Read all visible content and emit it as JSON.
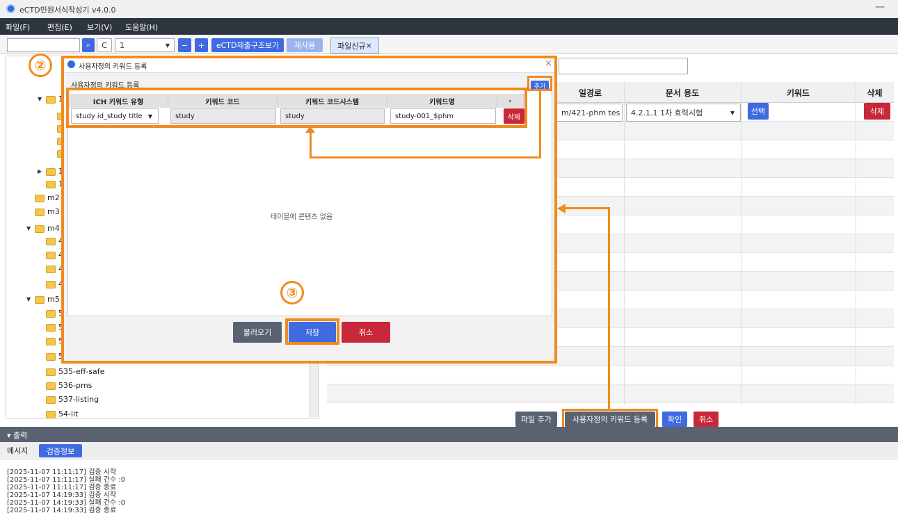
{
  "app": {
    "title": "eCTD민원서식작성기 v4.0.0",
    "minimize": "—"
  },
  "menu": [
    "파일(F)",
    "편집(E)",
    "보기(V)",
    "도움말(H)"
  ],
  "toolbar": {
    "page_value": "1",
    "refresh_icon": "C",
    "minus": "−",
    "plus": "+",
    "structure_btn": "eCTD제출구조보기",
    "reuse_btn": "재사용",
    "tab": "파일신규",
    "tab_close": "×"
  },
  "tree": [
    {
      "label": "1",
      "indent": 1,
      "toggle": "▼"
    },
    {
      "label": "",
      "indent": 2
    },
    {
      "label": "",
      "indent": 2
    },
    {
      "label": "",
      "indent": 2
    },
    {
      "label": "",
      "indent": 2
    },
    {
      "label": "1",
      "indent": 1,
      "toggle": "▶"
    },
    {
      "label": "1",
      "indent": 1
    },
    {
      "label": "m2",
      "indent": 0
    },
    {
      "label": "m3",
      "indent": 0
    },
    {
      "label": "m4",
      "indent": 0,
      "toggle": "▼"
    },
    {
      "label": "4",
      "indent": 1
    },
    {
      "label": "4",
      "indent": 1
    },
    {
      "label": "4",
      "indent": 1
    },
    {
      "label": "4",
      "indent": 1
    },
    {
      "label": "m5",
      "indent": 0,
      "toggle": "▼"
    },
    {
      "label": "5",
      "indent": 1
    },
    {
      "label": "5",
      "indent": 1
    },
    {
      "label": "5",
      "indent": 1
    },
    {
      "label": "5",
      "indent": 1
    },
    {
      "label": "535-eff-safe",
      "indent": 1
    },
    {
      "label": "536-pms",
      "indent": 1
    },
    {
      "label": "537-listing",
      "indent": 1
    },
    {
      "label": "54-lit",
      "indent": 1
    }
  ],
  "grid": {
    "headers": {
      "path": "일경로",
      "purpose": "문서 용도",
      "keyword": "키워드",
      "delete": "삭제"
    },
    "row1": {
      "path": "m/421-phm tes",
      "purpose": "4.2.1.1 1차 효력시험",
      "select_btn": "선택",
      "delete_btn": "삭제"
    }
  },
  "bottom_buttons": {
    "add_file": "파일 추가",
    "user_keyword": "사용자정의 키워드 등록",
    "confirm": "확인",
    "cancel": "취소"
  },
  "output": {
    "title": "▾ 출력",
    "tabs": [
      "메시지",
      "검증정보"
    ],
    "logs": [
      "[2025-11-07 11:11:17]  검증 시작",
      "[2025-11-07 11:11:17]  실패 건수 :0",
      "[2025-11-07 11:11:17]  검증 종료",
      "[2025-11-07 14:19:33]  검증 시작",
      "[2025-11-07 14:19:33]  실패 건수 :0",
      "[2025-11-07 14:19:33]  검증 종료"
    ]
  },
  "dialog": {
    "title": "사용자정의 키워드 등록",
    "close": "×",
    "section": "사용자정의 키워드 등록",
    "add_btn": "추가",
    "cols": [
      "ICH 키워드 유형",
      "키워드 코드",
      "키워드 코드시스템",
      "키워드명",
      "-"
    ],
    "row": {
      "type": "study id_study title",
      "code": "study",
      "system": "study",
      "name": "study-001_$phm",
      "delete": "삭제"
    },
    "empty": "테이블에 콘텐츠 없음",
    "load_btn": "불러오기",
    "save_btn": "저장",
    "cancel_btn": "취소"
  },
  "annotations": {
    "step2": "②",
    "step3": "③"
  }
}
